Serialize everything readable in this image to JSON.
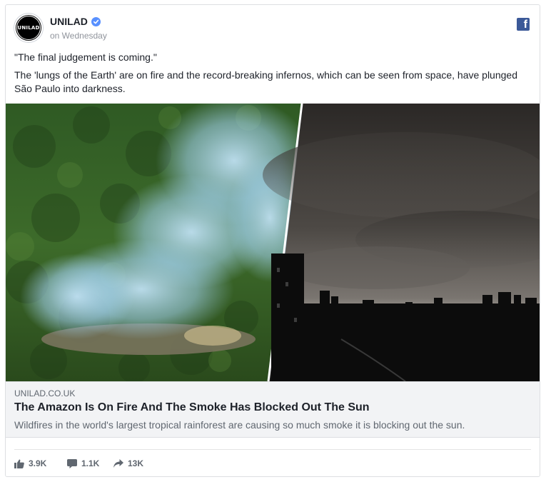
{
  "post": {
    "page_name": "UNILAD",
    "avatar_text": "UNILAD",
    "timestamp": "on Wednesday",
    "quote": "\"The final judgement is coming.\"",
    "body": "The 'lungs of the Earth' are on fire and the record-breaking infernos, which can be seen from space, have plunged São Paulo into darkness.",
    "platform_icon": "facebook-icon"
  },
  "link_preview": {
    "domain": "UNILAD.CO.UK",
    "title": "The Amazon Is On Fire And The Smoke Has Blocked Out The Sun",
    "description": "Wildfires in the world's largest tropical rainforest are causing so much smoke it is blocking out the sun."
  },
  "stats": {
    "likes": "3.9K",
    "comments": "1.1K",
    "shares": "13K"
  },
  "colors": {
    "facebook_blue": "#3b5998",
    "verified_blue": "#5890ff",
    "muted_text": "#606770"
  }
}
